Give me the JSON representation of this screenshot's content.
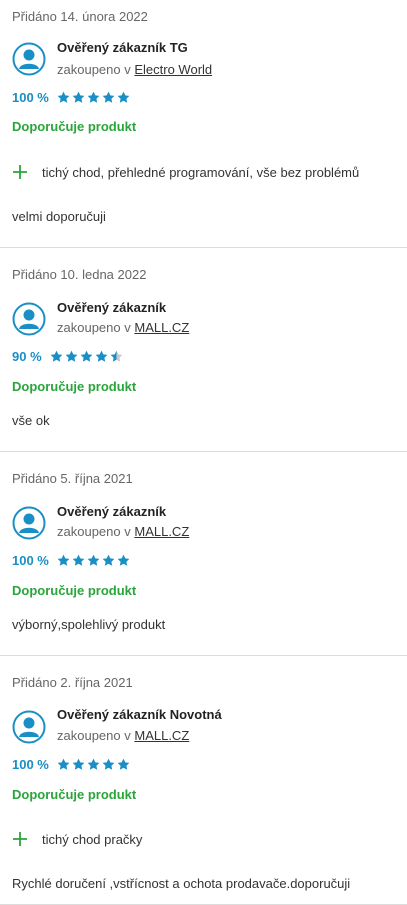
{
  "reviews": [
    {
      "date": "Přidáno 14. února 2022",
      "author": "Ověřený zákazník TG",
      "purchased_prefix": "zakoupeno v",
      "shop": "Electro World",
      "percent": "100 %",
      "rating": 5,
      "recommend": "Doporučuje produkt",
      "pro": "tichý chod, přehledné programování, vše bez problémů",
      "text": "velmi doporučuji"
    },
    {
      "date": "Přidáno 10. ledna 2022",
      "author": "Ověřený zákazník",
      "purchased_prefix": "zakoupeno v",
      "shop": "MALL.CZ",
      "percent": "90 %",
      "rating": 4.5,
      "recommend": "Doporučuje produkt",
      "text": "vše ok"
    },
    {
      "date": "Přidáno 5. října 2021",
      "author": "Ověřený zákazník",
      "purchased_prefix": "zakoupeno v",
      "shop": "MALL.CZ",
      "percent": "100 %",
      "rating": 5,
      "recommend": "Doporučuje produkt",
      "text": "výborný,spolehlivý produkt"
    },
    {
      "date": "Přidáno 2. října 2021",
      "author": "Ověřený zákazník Novotná",
      "purchased_prefix": "zakoupeno v",
      "shop": "MALL.CZ",
      "percent": "100 %",
      "rating": 5,
      "recommend": "Doporučuje produkt",
      "pro": "tichý chod pračky",
      "text": "Rychlé doručení ,vstřícnost a ochota prodavače.doporučuji"
    }
  ],
  "colors": {
    "accent_blue": "#1a8fc5",
    "recommend_green": "#2aa53b",
    "divider": "#dcdcdc"
  },
  "icons": {
    "avatar": "user-avatar-icon",
    "star": "star-icon",
    "pro": "plus-icon"
  }
}
